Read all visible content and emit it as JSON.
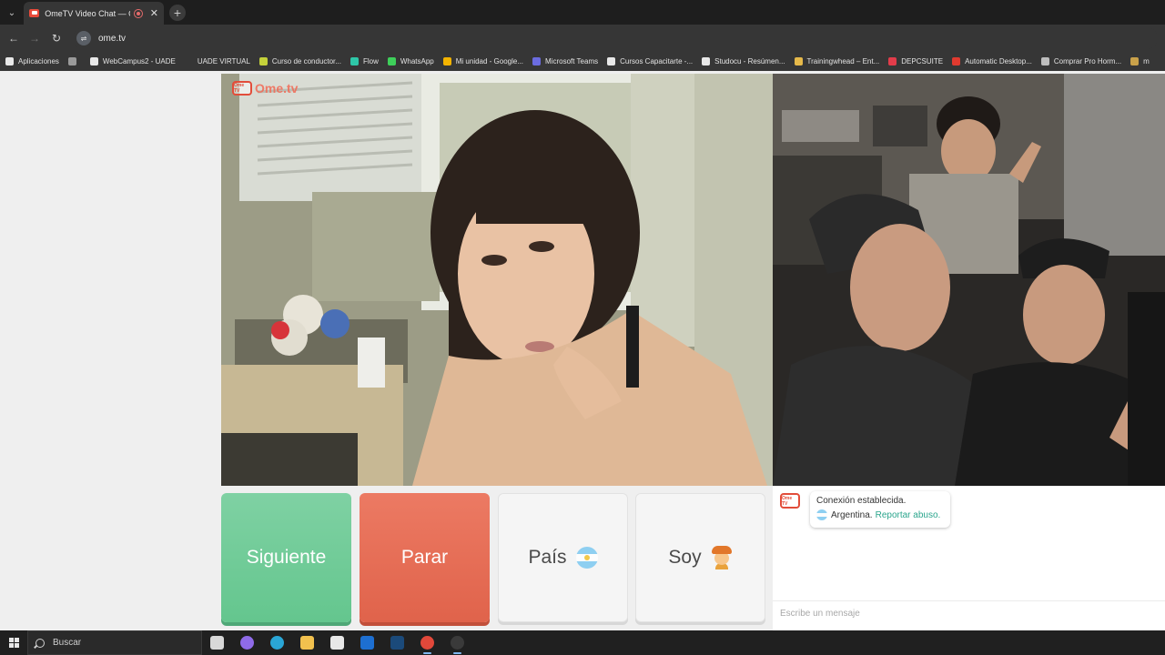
{
  "browser": {
    "tab_title": "OmeTV Video Chat — Ome",
    "tab_close": "✕",
    "new_tab": "+",
    "url": "ome.tv",
    "site_chip_icon": "tune-icon"
  },
  "bookmarks": [
    {
      "label": "Aplicaciones",
      "color": "#e8e8e8"
    },
    {
      "label": "",
      "color": "#9a9a9a"
    },
    {
      "label": "WebCampus2 - UADE",
      "color": "#e8e8e8"
    },
    {
      "label": "UADE VIRTUAL",
      "color": "#363636"
    },
    {
      "label": "Curso de conductor...",
      "color": "#c4d13a"
    },
    {
      "label": "Flow",
      "color": "#2ec7a8"
    },
    {
      "label": "WhatsApp",
      "color": "#3ecf5a"
    },
    {
      "label": "Mi unidad - Google...",
      "color": "#f4b400"
    },
    {
      "label": "Microsoft Teams",
      "color": "#6b6ce0"
    },
    {
      "label": "Cursos Capacitarte -...",
      "color": "#e8e8e8"
    },
    {
      "label": "Studocu - Resúmen...",
      "color": "#e8e8e8"
    },
    {
      "label": "Trainingwhead – Ent...",
      "color": "#e6b94a"
    },
    {
      "label": "DEPCSUITE",
      "color": "#e23c4a"
    },
    {
      "label": "Automatic Desktop...",
      "color": "#e03a2f"
    },
    {
      "label": "Comprar Pro Horm...",
      "color": "#bdbdbd"
    },
    {
      "label": "m",
      "color": "#c9a14a"
    }
  ],
  "video": {
    "logo_badge": "Ome TV",
    "logo_text": "Ome.tv"
  },
  "controls": {
    "next_label": "Siguiente",
    "stop_label": "Parar",
    "country_label": "País",
    "soy_label": "Soy"
  },
  "chat": {
    "status": "Conexión establecida.",
    "country": "Argentina.",
    "report": "Reportar abuso.",
    "placeholder": "Escribe un mensaje",
    "logo_badge": "Ome TV"
  },
  "taskbar": {
    "search_placeholder": "Buscar",
    "icons": [
      {
        "name": "task-view-icon",
        "color": "#d8d8d8"
      },
      {
        "name": "copilot-icon",
        "color": "#8f6be8"
      },
      {
        "name": "edge-icon",
        "color": "#2aa6d6"
      },
      {
        "name": "file-explorer-icon",
        "color": "#f2c14e"
      },
      {
        "name": "store-icon",
        "color": "#e8e8e8"
      },
      {
        "name": "outlook-icon",
        "color": "#1d6fd1"
      },
      {
        "name": "steam-icon",
        "color": "#1b4a7a"
      },
      {
        "name": "chrome-icon",
        "color": "#e2483a"
      },
      {
        "name": "obs-icon",
        "color": "#3a3a3a"
      }
    ]
  }
}
